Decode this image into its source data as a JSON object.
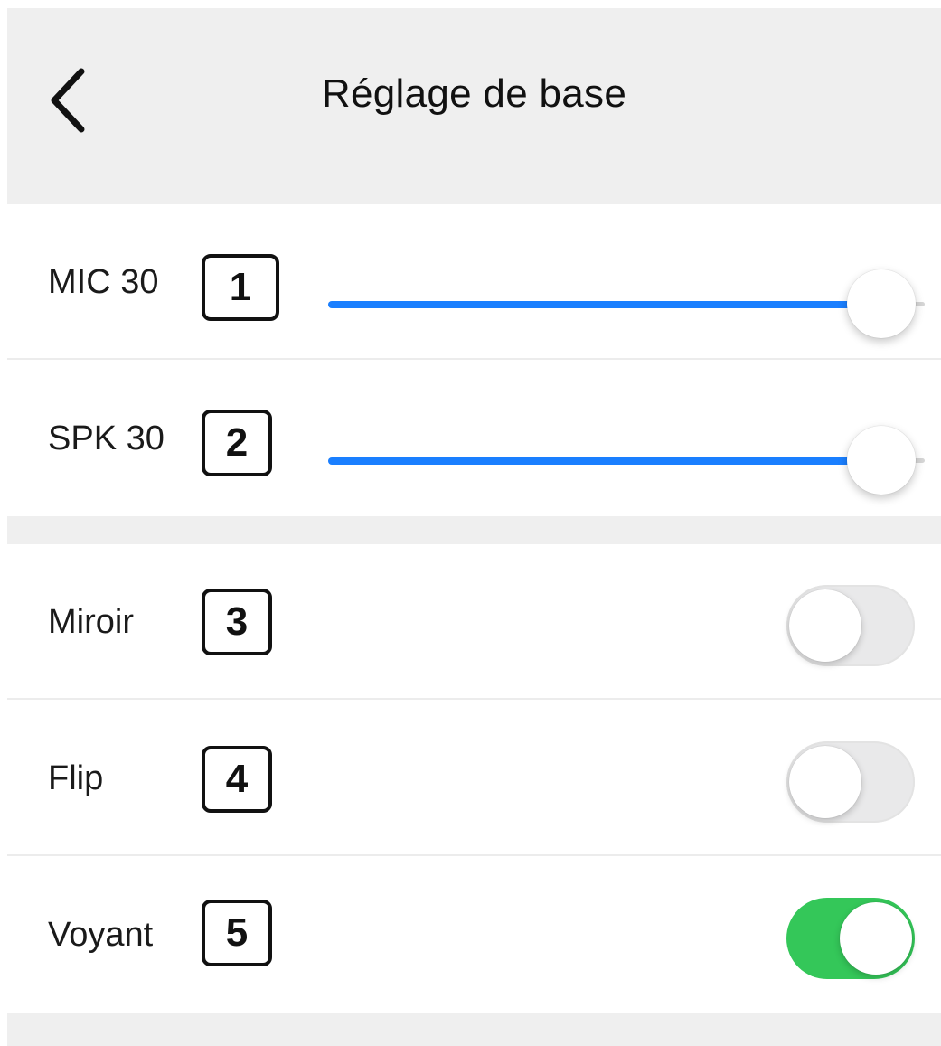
{
  "header": {
    "title": "Réglage de base",
    "back_icon": "chevron-left-icon"
  },
  "sliders": [
    {
      "label": "MIC 30",
      "marker": "1",
      "value_fraction": 1.0,
      "fill_color": "#1a7fff"
    },
    {
      "label": "SPK 30",
      "marker": "2",
      "value_fraction": 1.0,
      "fill_color": "#1a7fff"
    }
  ],
  "toggles": [
    {
      "label": "Miroir",
      "marker": "3",
      "state": "off"
    },
    {
      "label": "Flip",
      "marker": "4",
      "state": "off"
    },
    {
      "label": "Voyant",
      "marker": "5",
      "state": "on",
      "on_color": "#34c759"
    }
  ]
}
